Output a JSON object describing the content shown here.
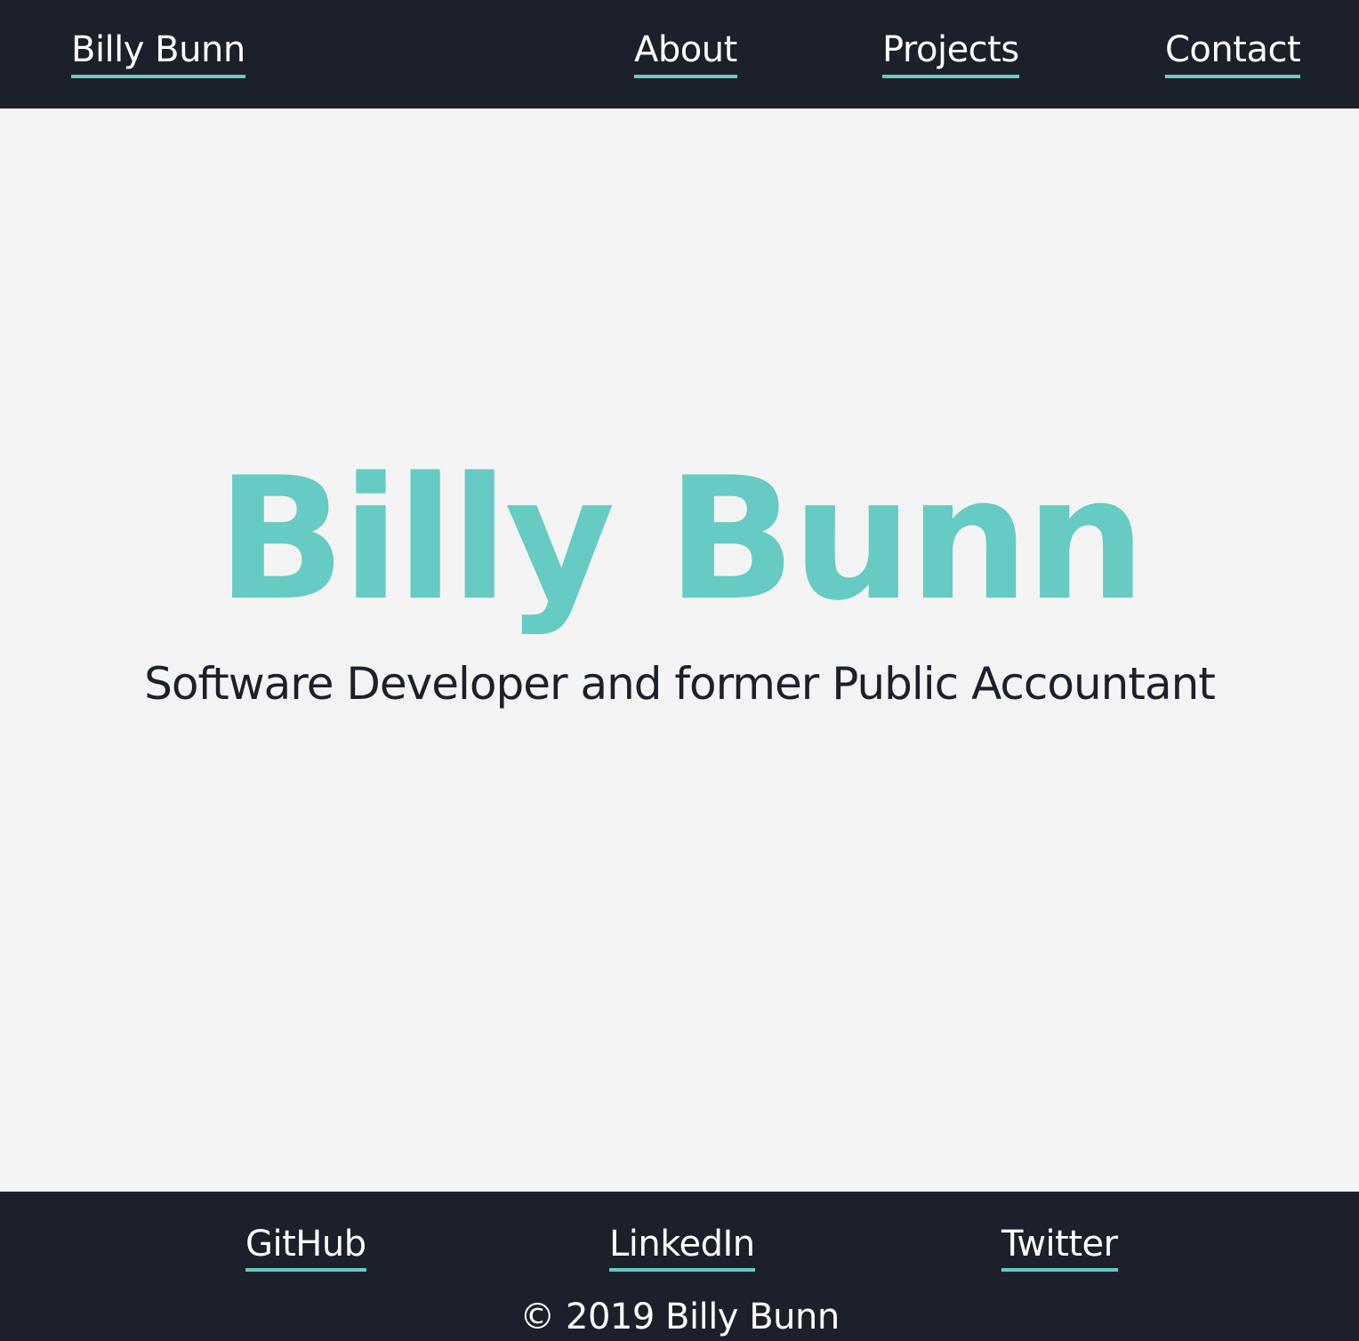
{
  "colors": {
    "header_background": "#1b202a",
    "page_background": "#f4f4f4",
    "accent": "#66cbc3",
    "link_text": "#ffffff",
    "subtitle_text": "#1b202a"
  },
  "header": {
    "brand": "Billy Bunn",
    "nav": {
      "about": "About",
      "projects": "Projects",
      "contact": "Contact"
    }
  },
  "hero": {
    "title": "Billy Bunn",
    "subtitle": "Software Developer and former Public Accountant"
  },
  "footer": {
    "links": {
      "github": "GitHub",
      "linkedin": "LinkedIn",
      "twitter": "Twitter"
    },
    "copyright": "© 2019 Billy Bunn"
  }
}
